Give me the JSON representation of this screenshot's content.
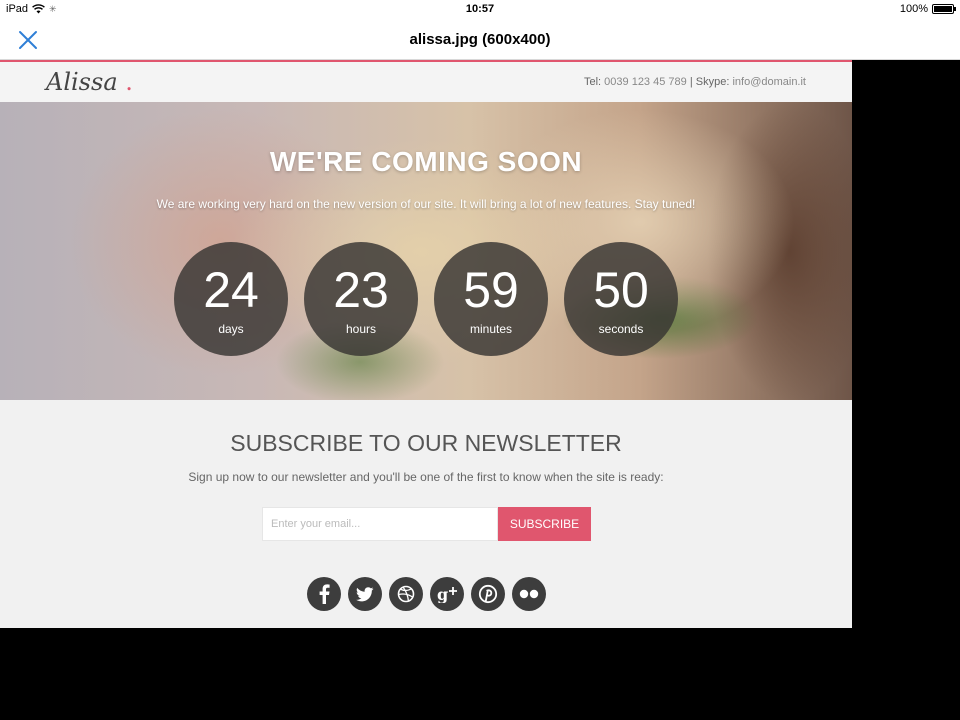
{
  "status_bar": {
    "device": "iPad",
    "time": "10:57",
    "battery": "100%",
    "battery_level": 1.0
  },
  "nav": {
    "title": "alissa.jpg (600x400)",
    "close_icon": "close-x-icon"
  },
  "site": {
    "logo": "Alissa",
    "logo_dot": ".",
    "contact": {
      "tel_label": "Tel:",
      "tel": "0039 123 45 789",
      "separator": "|",
      "skype_label": "Skype:",
      "skype": "info@domain.it"
    },
    "hero": {
      "title": "WE'RE COMING SOON",
      "subtitle": "We are working very hard on the new version of our site. It will bring a lot of new features. Stay tuned!"
    },
    "countdown": [
      {
        "value": "24",
        "label": "days"
      },
      {
        "value": "23",
        "label": "hours"
      },
      {
        "value": "59",
        "label": "minutes"
      },
      {
        "value": "50",
        "label": "seconds"
      }
    ],
    "newsletter": {
      "title": "SUBSCRIBE TO OUR NEWSLETTER",
      "subtitle": "Sign up now to our newsletter and you'll be one of the first to know when the site is ready:",
      "email_placeholder": "Enter your email...",
      "button_label": "SUBSCRIBE"
    },
    "socials": [
      "facebook-icon",
      "twitter-icon",
      "dribbble-icon",
      "google-plus-icon",
      "pinterest-icon",
      "flickr-icon"
    ]
  },
  "colors": {
    "accent": "#e0566e",
    "ios_blue": "#2f7fd6",
    "dark_circle": "#373432"
  }
}
